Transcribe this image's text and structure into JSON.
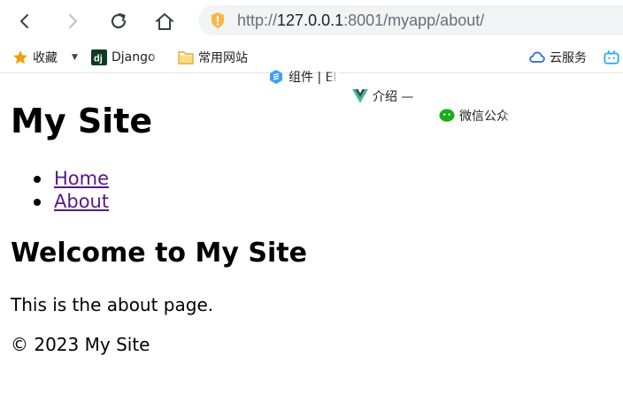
{
  "browser": {
    "url": {
      "host": "127.0.0.1",
      "rest": ":8001/myapp/about/"
    }
  },
  "bookmarks": [
    {
      "label": "收藏",
      "icon": "star-icon"
    },
    {
      "label": "Django",
      "icon": "django-icon"
    },
    {
      "label": "常用网站",
      "icon": "folder-icon"
    },
    {
      "label": "组件 | El",
      "icon": "element-icon"
    },
    {
      "label": "介绍 —",
      "icon": "vue-icon"
    },
    {
      "label": "微信公众",
      "icon": "wechat-icon"
    },
    {
      "label": "云服务",
      "icon": "cloud-icon"
    },
    {
      "label": "",
      "icon": "bilibili-icon"
    }
  ],
  "page": {
    "site_title": "My Site",
    "nav": [
      {
        "label": "Home"
      },
      {
        "label": "About"
      }
    ],
    "heading": "Welcome to My Site",
    "body_text": "This is the about page.",
    "footer": "© 2023 My Site"
  },
  "colors": {
    "visited_link": "#551a8b",
    "url_bar_bg": "#f1f3f4",
    "shield": "#f5b94a",
    "star": "#f29d0c",
    "folder": "#f3c54a",
    "django": "#0c3c26",
    "element": "#409eff",
    "vue": "#42b883",
    "wechat": "#1aad19",
    "cloud": "#2c6ee8",
    "bilibili": "#23ade5"
  }
}
